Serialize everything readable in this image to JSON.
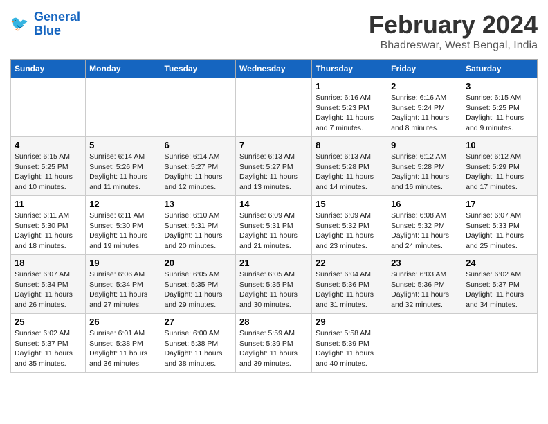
{
  "header": {
    "logo_line1": "General",
    "logo_line2": "Blue",
    "title": "February 2024",
    "subtitle": "Bhadreswar, West Bengal, India"
  },
  "weekdays": [
    "Sunday",
    "Monday",
    "Tuesday",
    "Wednesday",
    "Thursday",
    "Friday",
    "Saturday"
  ],
  "weeks": [
    [
      {
        "day": "",
        "text": ""
      },
      {
        "day": "",
        "text": ""
      },
      {
        "day": "",
        "text": ""
      },
      {
        "day": "",
        "text": ""
      },
      {
        "day": "1",
        "text": "Sunrise: 6:16 AM\nSunset: 5:23 PM\nDaylight: 11 hours\nand 7 minutes."
      },
      {
        "day": "2",
        "text": "Sunrise: 6:16 AM\nSunset: 5:24 PM\nDaylight: 11 hours\nand 8 minutes."
      },
      {
        "day": "3",
        "text": "Sunrise: 6:15 AM\nSunset: 5:25 PM\nDaylight: 11 hours\nand 9 minutes."
      }
    ],
    [
      {
        "day": "4",
        "text": "Sunrise: 6:15 AM\nSunset: 5:25 PM\nDaylight: 11 hours\nand 10 minutes."
      },
      {
        "day": "5",
        "text": "Sunrise: 6:14 AM\nSunset: 5:26 PM\nDaylight: 11 hours\nand 11 minutes."
      },
      {
        "day": "6",
        "text": "Sunrise: 6:14 AM\nSunset: 5:27 PM\nDaylight: 11 hours\nand 12 minutes."
      },
      {
        "day": "7",
        "text": "Sunrise: 6:13 AM\nSunset: 5:27 PM\nDaylight: 11 hours\nand 13 minutes."
      },
      {
        "day": "8",
        "text": "Sunrise: 6:13 AM\nSunset: 5:28 PM\nDaylight: 11 hours\nand 14 minutes."
      },
      {
        "day": "9",
        "text": "Sunrise: 6:12 AM\nSunset: 5:28 PM\nDaylight: 11 hours\nand 16 minutes."
      },
      {
        "day": "10",
        "text": "Sunrise: 6:12 AM\nSunset: 5:29 PM\nDaylight: 11 hours\nand 17 minutes."
      }
    ],
    [
      {
        "day": "11",
        "text": "Sunrise: 6:11 AM\nSunset: 5:30 PM\nDaylight: 11 hours\nand 18 minutes."
      },
      {
        "day": "12",
        "text": "Sunrise: 6:11 AM\nSunset: 5:30 PM\nDaylight: 11 hours\nand 19 minutes."
      },
      {
        "day": "13",
        "text": "Sunrise: 6:10 AM\nSunset: 5:31 PM\nDaylight: 11 hours\nand 20 minutes."
      },
      {
        "day": "14",
        "text": "Sunrise: 6:09 AM\nSunset: 5:31 PM\nDaylight: 11 hours\nand 21 minutes."
      },
      {
        "day": "15",
        "text": "Sunrise: 6:09 AM\nSunset: 5:32 PM\nDaylight: 11 hours\nand 23 minutes."
      },
      {
        "day": "16",
        "text": "Sunrise: 6:08 AM\nSunset: 5:32 PM\nDaylight: 11 hours\nand 24 minutes."
      },
      {
        "day": "17",
        "text": "Sunrise: 6:07 AM\nSunset: 5:33 PM\nDaylight: 11 hours\nand 25 minutes."
      }
    ],
    [
      {
        "day": "18",
        "text": "Sunrise: 6:07 AM\nSunset: 5:34 PM\nDaylight: 11 hours\nand 26 minutes."
      },
      {
        "day": "19",
        "text": "Sunrise: 6:06 AM\nSunset: 5:34 PM\nDaylight: 11 hours\nand 27 minutes."
      },
      {
        "day": "20",
        "text": "Sunrise: 6:05 AM\nSunset: 5:35 PM\nDaylight: 11 hours\nand 29 minutes."
      },
      {
        "day": "21",
        "text": "Sunrise: 6:05 AM\nSunset: 5:35 PM\nDaylight: 11 hours\nand 30 minutes."
      },
      {
        "day": "22",
        "text": "Sunrise: 6:04 AM\nSunset: 5:36 PM\nDaylight: 11 hours\nand 31 minutes."
      },
      {
        "day": "23",
        "text": "Sunrise: 6:03 AM\nSunset: 5:36 PM\nDaylight: 11 hours\nand 32 minutes."
      },
      {
        "day": "24",
        "text": "Sunrise: 6:02 AM\nSunset: 5:37 PM\nDaylight: 11 hours\nand 34 minutes."
      }
    ],
    [
      {
        "day": "25",
        "text": "Sunrise: 6:02 AM\nSunset: 5:37 PM\nDaylight: 11 hours\nand 35 minutes."
      },
      {
        "day": "26",
        "text": "Sunrise: 6:01 AM\nSunset: 5:38 PM\nDaylight: 11 hours\nand 36 minutes."
      },
      {
        "day": "27",
        "text": "Sunrise: 6:00 AM\nSunset: 5:38 PM\nDaylight: 11 hours\nand 38 minutes."
      },
      {
        "day": "28",
        "text": "Sunrise: 5:59 AM\nSunset: 5:39 PM\nDaylight: 11 hours\nand 39 minutes."
      },
      {
        "day": "29",
        "text": "Sunrise: 5:58 AM\nSunset: 5:39 PM\nDaylight: 11 hours\nand 40 minutes."
      },
      {
        "day": "",
        "text": ""
      },
      {
        "day": "",
        "text": ""
      }
    ]
  ]
}
